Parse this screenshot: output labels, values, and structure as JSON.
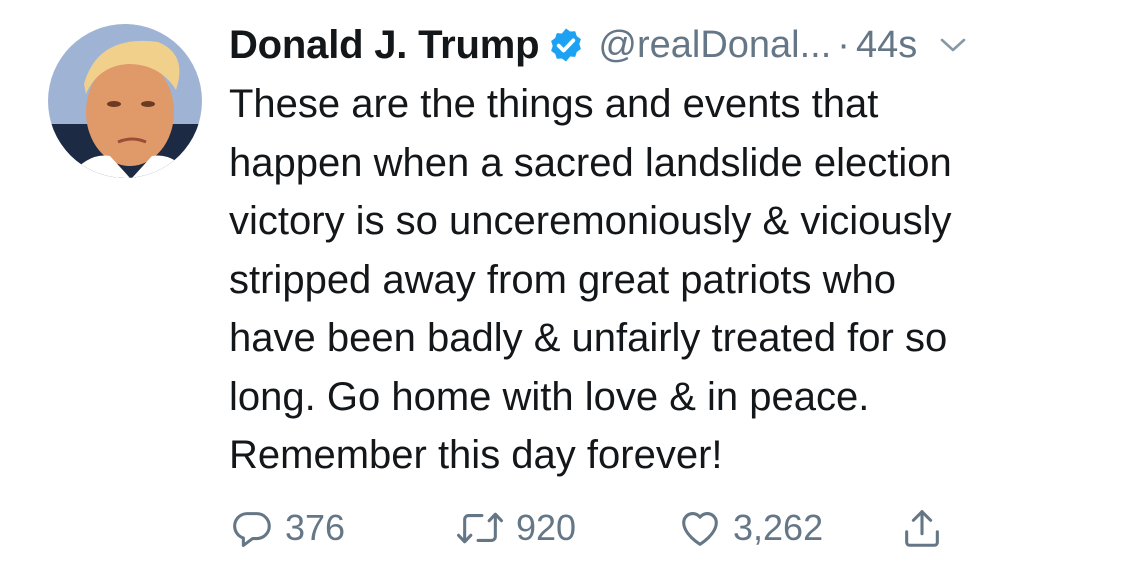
{
  "tweet": {
    "author_name": "Donald J. Trump",
    "handle": "@realDonal...",
    "separator": "·",
    "time": "44s",
    "text_lines": [
      "These are the things and events that",
      "happen when a sacred landslide election",
      "victory is so unceremoniously & viciously",
      "stripped away from great patriots who",
      "have been badly & unfairly treated for so",
      "long. Go home with love & in peace.",
      "Remember this day forever!"
    ],
    "replies": "376",
    "retweets": "920",
    "likes": "3,262"
  },
  "icons": {
    "verified": "verified-badge-icon",
    "caret": "chevron-down-icon",
    "reply": "reply-bubble-icon",
    "retweet": "retweet-icon",
    "like": "heart-icon",
    "share": "share-icon"
  },
  "colors": {
    "text": "#14171a",
    "secondary": "#657786",
    "verified_blue": "#1da1f2",
    "background": "#ffffff"
  }
}
